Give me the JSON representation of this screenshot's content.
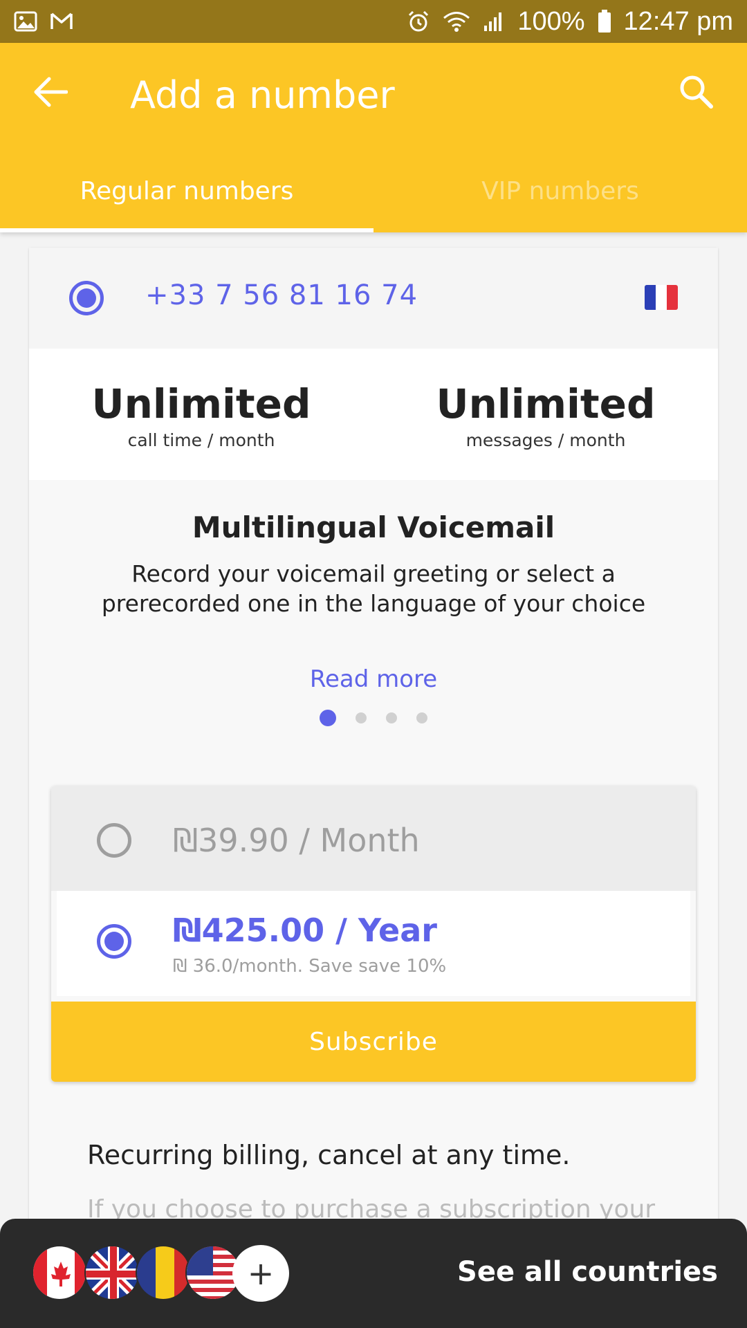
{
  "status_bar": {
    "battery": "100%",
    "time": "12:47 pm",
    "icons": [
      "image-icon",
      "gmail-icon",
      "alarm-icon",
      "wifi-icon",
      "signal-icon",
      "battery-icon"
    ]
  },
  "app_bar": {
    "title": "Add a number",
    "background_color": "#FCC625",
    "tabs": [
      {
        "label": "Regular numbers",
        "active": true
      },
      {
        "label": "VIP numbers",
        "active": false
      }
    ]
  },
  "number": {
    "phone": "+33 7 56 81 16 74",
    "selected": true,
    "country_flag": "france-flag"
  },
  "stats": [
    {
      "value": "Unlimited",
      "label": "call time / month"
    },
    {
      "value": "Unlimited",
      "label": "messages / month"
    }
  ],
  "feature": {
    "title": "Multilingual Voicemail",
    "description": "Record your voicemail greeting or select a prerecorded one in the language of your choice",
    "read_more": "Read more",
    "pager": {
      "count": 4,
      "active_index": 0
    }
  },
  "plans": [
    {
      "price": "₪39.90 / Month",
      "selected": false
    },
    {
      "price": "₪425.00 / Year",
      "detail": "₪ 36.0/month. Save save 10%",
      "selected": true
    }
  ],
  "subscribe_label": "Subscribe",
  "billing_text": "Recurring billing, cancel at any time.",
  "terms_text": "If you choose to purchase a subscription your",
  "bottom_bar": {
    "flags": [
      "canada-flag",
      "uk-flag",
      "romania-flag",
      "usa-flag"
    ],
    "plus": "+",
    "see_all": "See all countries"
  },
  "accent_color": "#5E63E8"
}
